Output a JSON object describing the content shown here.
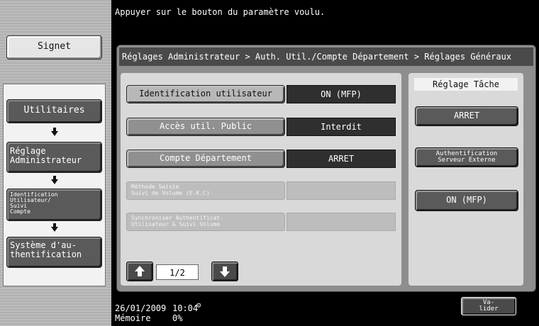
{
  "top_message": "Appuyer sur le bouton du paramètre voulu.",
  "breadcrumb": "Réglages Administrateur > Auth. Util./Compte Département > Réglages Généraux",
  "sidebar": {
    "signet": "Signet",
    "items": [
      {
        "label": "Utilitaires"
      },
      {
        "label": "Réglage\nAdministrateur"
      },
      {
        "label": "Identification\nUtilisateur/\nSuivi\nCompte"
      },
      {
        "label": "Système d'au-\nthentification"
      }
    ]
  },
  "settings": [
    {
      "label": "Identification utilisateur",
      "value": "ON (MFP)"
    },
    {
      "label": "Accès util. Public",
      "value": "Interdit"
    },
    {
      "label": "Compte Département",
      "value": "ARRET"
    },
    {
      "label": "Méthode Saisie\nSuivi de Volume (E.K.C)",
      "value": "",
      "disabled": true
    },
    {
      "label": "Synchroniser Authentificat.\nUtilisateur & Suivi Volume",
      "value": "",
      "disabled": true
    }
  ],
  "pagination": {
    "current": "1/2",
    "prev_icon": "up-arrow-icon",
    "next_icon": "down-arrow-icon"
  },
  "task_panel": {
    "title": "Réglage Tâche",
    "buttons": [
      {
        "label": "ARRET"
      },
      {
        "label": "Authentification\nServeur Externe"
      },
      {
        "label": "ON (MFP)"
      }
    ]
  },
  "status": {
    "date": "26/01/2009",
    "time": "10:04",
    "memory_label": "Mémoire",
    "memory_value": "0%",
    "network_icon": "network-icon"
  },
  "validate_label": "Va-\nlider"
}
